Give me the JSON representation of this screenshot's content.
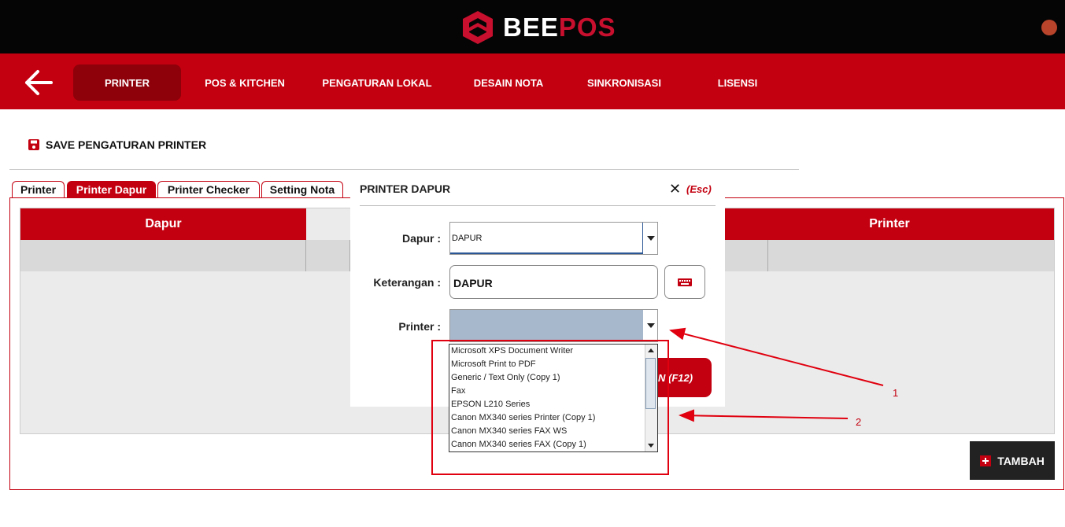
{
  "app": {
    "brand_part1": "BEE",
    "brand_part2": "POS"
  },
  "nav": {
    "items": [
      {
        "label": "PRINTER",
        "active": true
      },
      {
        "label": "POS & KITCHEN"
      },
      {
        "label": "PENGATURAN LOKAL"
      },
      {
        "label": "DESAIN NOTA"
      },
      {
        "label": "SINKRONISASI"
      },
      {
        "label": "LISENSI"
      }
    ]
  },
  "toolbar": {
    "save_label": "SAVE PENGATURAN PRINTER"
  },
  "tabs": [
    {
      "label": "Printer"
    },
    {
      "label": "Printer Dapur",
      "active": true
    },
    {
      "label": "Printer Checker"
    },
    {
      "label": "Setting Nota"
    }
  ],
  "table": {
    "columns": [
      "Dapur",
      "Printer"
    ]
  },
  "actions": {
    "tambah_label": "TAMBAH"
  },
  "dialog": {
    "title": "PRINTER DAPUR",
    "close_hint": "(Esc)",
    "dapur_label": "Dapur :",
    "dapur_value": "DAPUR",
    "keterangan_label": "Keterangan :",
    "keterangan_value": "DAPUR",
    "printer_label": "Printer :",
    "save_label_visible": "N (F12)",
    "printer_options": [
      "Microsoft XPS Document Writer",
      "Microsoft Print to PDF",
      "Generic / Text Only (Copy 1)",
      "Fax",
      "EPSON L210 Series",
      "Canon MX340 series Printer (Copy 1)",
      "Canon MX340 series FAX WS",
      "Canon MX340 series FAX (Copy 1)"
    ]
  },
  "annotations": {
    "marker1": "1",
    "marker2": "2"
  },
  "colors": {
    "brand_red": "#c30010",
    "dark_red": "#8e000a",
    "topbar": "#050505",
    "annotation_red": "#e0000f"
  }
}
